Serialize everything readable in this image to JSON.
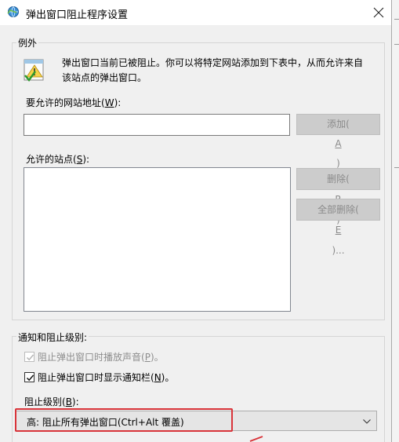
{
  "window": {
    "title": "弹出窗口阻止程序设置",
    "icon": "ie-globe-icon"
  },
  "exceptions": {
    "legend": "例外",
    "info_icon": "warning-page-icon",
    "info_line1": "弹出窗口当前已被阻止。你可以将特定网站添加到下表中，从而允许来自",
    "info_line2": "该站点的弹出窗口。",
    "address_label_pre": "要允许的网站地址(",
    "address_label_key": "W",
    "address_label_post": "):",
    "address_value": "",
    "add_pre": "添加(",
    "add_key": "A",
    "add_post": ")",
    "sites_label_pre": "允许的站点(",
    "sites_label_key": "S",
    "sites_label_post": "):",
    "sites": [],
    "remove_pre": "删除(",
    "remove_key": "R",
    "remove_post": ")",
    "remove_all_pre": "全部删除(",
    "remove_all_key": "E",
    "remove_all_post": ")..."
  },
  "notification": {
    "legend": "通知和阻止级别:",
    "sound_pre": "阻止弹出窗口时播放声音(",
    "sound_key": "P",
    "sound_post": ")。",
    "sound_checked": true,
    "sound_enabled": false,
    "notify_pre": "阻止弹出窗口时显示通知栏(",
    "notify_key": "N",
    "notify_post": ")。",
    "notify_checked": true,
    "level_label_pre": "阻止级别(",
    "level_label_key": "B",
    "level_label_post": "):",
    "level_value": "高: 阻止所有弹出窗口(Ctrl+Alt 覆盖)",
    "highlight_color": "#d9343a"
  }
}
